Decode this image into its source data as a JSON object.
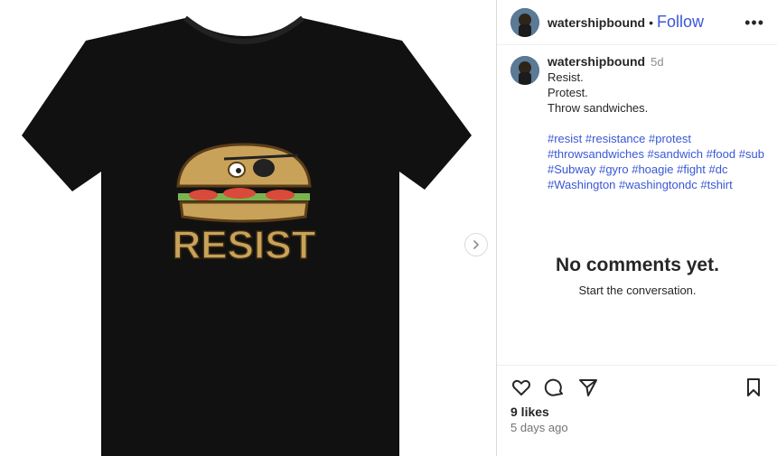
{
  "post": {
    "username": "watershipbound",
    "follow_label": "Follow",
    "more_label": "•••",
    "caption_age": "5d",
    "caption_lines": [
      "Resist.",
      "Protest.",
      "Throw sandwiches."
    ],
    "hashtags": [
      "#resist #resistance #protest",
      "#throwsandwiches #sandwich #food #sub",
      "#Subway #gyro #hoagie #fight #dc",
      "#Washington #washingtondc #tshirt"
    ],
    "empty_title": "No comments yet.",
    "empty_subtitle": "Start the conversation.",
    "likes": "9 likes",
    "time": "5 days ago"
  },
  "media": {
    "shirt_text": "RESIST",
    "icons": [
      "next-arrow-icon"
    ]
  },
  "actions": {
    "icons": [
      "heart-icon",
      "comment-icon",
      "share-icon",
      "bookmark-icon"
    ]
  },
  "colors": {
    "link": "#3a57d6",
    "shirt": "#111111",
    "bun": "#c9a25a",
    "text_muted": "#8e8e8e"
  }
}
